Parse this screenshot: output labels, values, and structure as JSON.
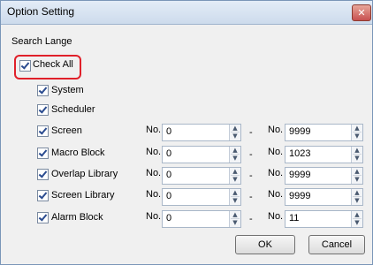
{
  "window": {
    "title": "Option Setting",
    "close_glyph": "✕"
  },
  "search_range": {
    "label": "Search Lange",
    "check_all": {
      "label": "Check All",
      "checked": true
    },
    "items": [
      {
        "label": "System",
        "checked": true
      },
      {
        "label": "Scheduler",
        "checked": true
      },
      {
        "label": "Screen",
        "checked": true,
        "from": "0",
        "to": "9999"
      },
      {
        "label": "Macro Block",
        "checked": true,
        "from": "0",
        "to": "1023"
      },
      {
        "label": "Overlap Library",
        "checked": true,
        "from": "0",
        "to": "9999"
      },
      {
        "label": "Screen Library",
        "checked": true,
        "from": "0",
        "to": "9999"
      },
      {
        "label": "Alarm Block",
        "checked": true,
        "from": "0",
        "to": "11"
      }
    ],
    "no_label": "No.",
    "range_sep": "-"
  },
  "buttons": {
    "ok": "OK",
    "cancel": "Cancel"
  },
  "colors": {
    "highlight": "#e0202a"
  }
}
